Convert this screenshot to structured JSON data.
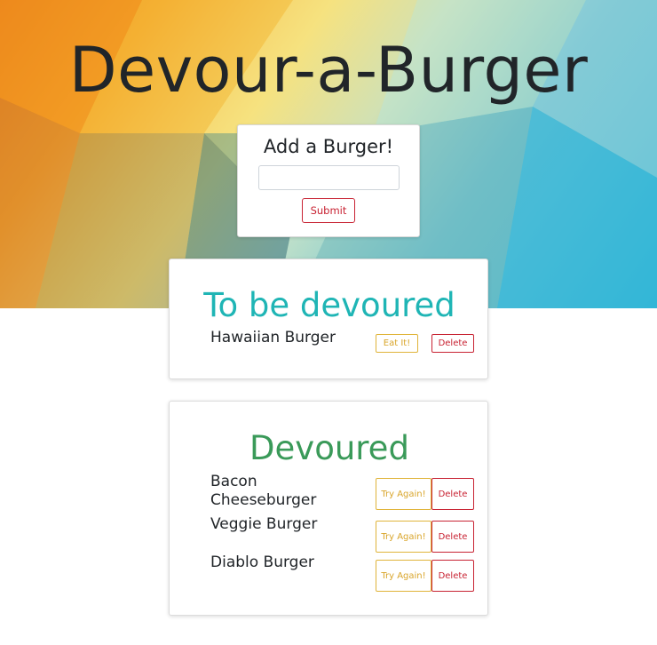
{
  "app": {
    "title": "Devour-a-Burger"
  },
  "add_form": {
    "title": "Add a Burger!",
    "input_value": "",
    "input_placeholder": "",
    "submit_label": "Submit"
  },
  "to_be_devoured": {
    "heading": "To be devoured",
    "items": [
      {
        "name": "Hawaiian Burger",
        "eat_label": "Eat It!",
        "delete_label": "Delete"
      }
    ]
  },
  "devoured": {
    "heading": "Devoured",
    "items": [
      {
        "name": "Bacon Cheeseburger",
        "try_label": "Try Again!",
        "delete_label": "Delete"
      },
      {
        "name": "Veggie Burger",
        "try_label": "Try Again!",
        "delete_label": "Delete"
      },
      {
        "name": "Diablo Burger",
        "try_label": "Try Again!",
        "delete_label": "Delete"
      }
    ]
  },
  "colors": {
    "todo_heading": "#1fb5b5",
    "devoured_heading": "#3a9a59",
    "warning": "#e0b43a",
    "danger": "#c82333"
  }
}
